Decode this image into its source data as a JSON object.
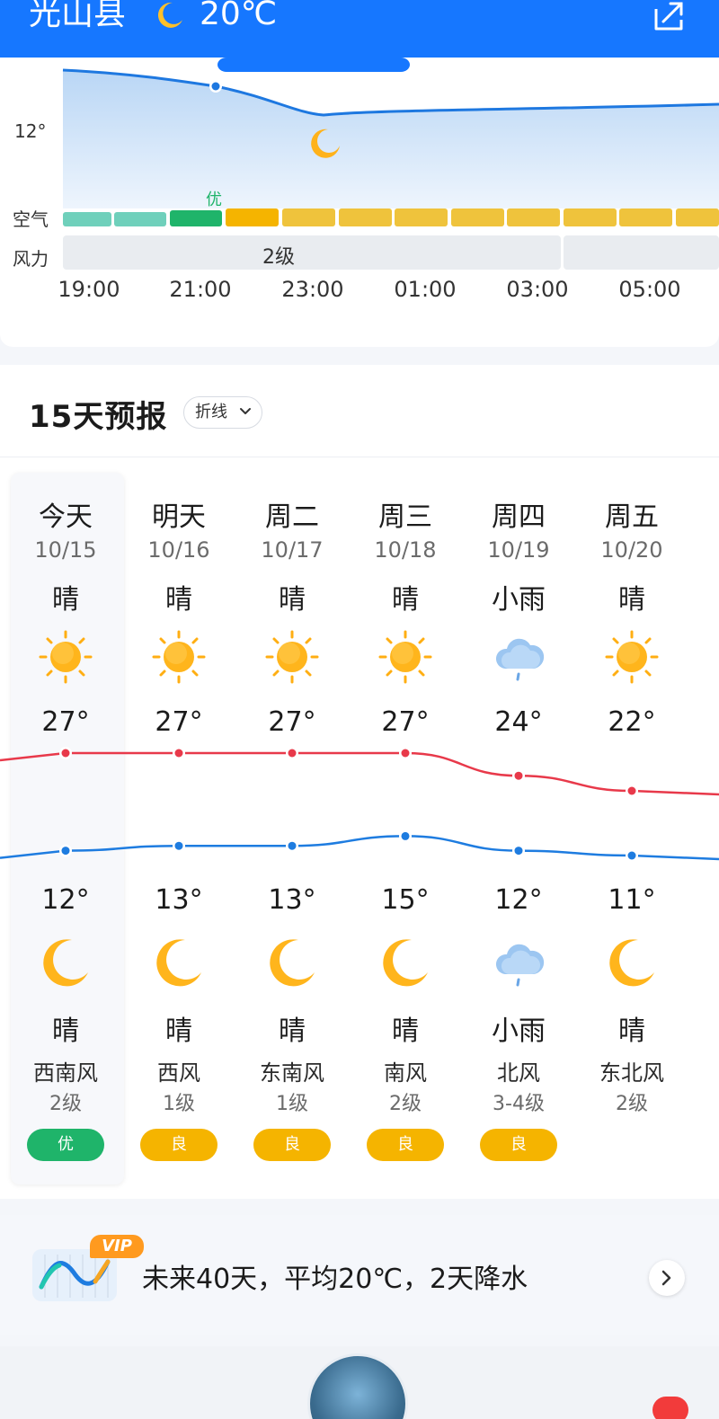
{
  "header": {
    "title": "光山县",
    "moon_icon": "moon-icon",
    "temp": "20℃",
    "share_icon": "share-icon",
    "bg_color": "#1677ff"
  },
  "hourly": {
    "temp_labels": [
      "12°"
    ],
    "air_label": "空气",
    "wind_label": "风力",
    "aq_marker": "优",
    "wind_value": "2级",
    "times": [
      "19:00",
      "21:00",
      "23:00",
      "01:00",
      "03:00",
      "05:00"
    ]
  },
  "daily": {
    "title": "15天预报",
    "toggle_label": "折线",
    "days": [
      {
        "day": "今天",
        "date": "10/15",
        "day_weather": "晴",
        "day_icon": "sun-icon",
        "high": "27°",
        "low": "12°",
        "night_icon": "moon-icon",
        "night_weather": "晴",
        "wind": "西南风",
        "level": "2级",
        "aq": "优",
        "aq_color": "#1fb46a"
      },
      {
        "day": "明天",
        "date": "10/16",
        "day_weather": "晴",
        "day_icon": "sun-icon",
        "high": "27°",
        "low": "13°",
        "night_icon": "moon-icon",
        "night_weather": "晴",
        "wind": "西风",
        "level": "1级",
        "aq": "良",
        "aq_color": "#f5b400"
      },
      {
        "day": "周二",
        "date": "10/17",
        "day_weather": "晴",
        "day_icon": "sun-icon",
        "high": "27°",
        "low": "13°",
        "night_icon": "moon-icon",
        "night_weather": "晴",
        "wind": "东南风",
        "level": "1级",
        "aq": "良",
        "aq_color": "#f5b400"
      },
      {
        "day": "周三",
        "date": "10/18",
        "day_weather": "晴",
        "day_icon": "sun-icon",
        "high": "27°",
        "low": "15°",
        "night_icon": "moon-icon",
        "night_weather": "晴",
        "wind": "南风",
        "level": "2级",
        "aq": "良",
        "aq_color": "#f5b400"
      },
      {
        "day": "周四",
        "date": "10/19",
        "day_weather": "小雨",
        "day_icon": "rain-cloud-icon",
        "high": "24°",
        "low": "12°",
        "night_icon": "rain-cloud-icon",
        "night_weather": "小雨",
        "wind": "北风",
        "level": "3-4级",
        "aq": "良",
        "aq_color": "#f5b400"
      },
      {
        "day": "周五",
        "date": "10/20",
        "day_weather": "晴",
        "day_icon": "sun-icon",
        "high": "22°",
        "low": "11°",
        "night_icon": "moon-icon",
        "night_weather": "晴",
        "wind": "东北风",
        "level": "2级",
        "aq": "",
        "aq_color": ""
      }
    ],
    "high_values": [
      27,
      27,
      27,
      27,
      24,
      22
    ],
    "low_values": [
      12,
      13,
      13,
      15,
      12,
      11
    ],
    "high_color": "#e8394a",
    "low_color": "#1e7ce0"
  },
  "banner": {
    "vip": "VIP",
    "text": "未来40天，平均20℃，2天降水",
    "arrow_icon": "chevron-right-icon"
  }
}
